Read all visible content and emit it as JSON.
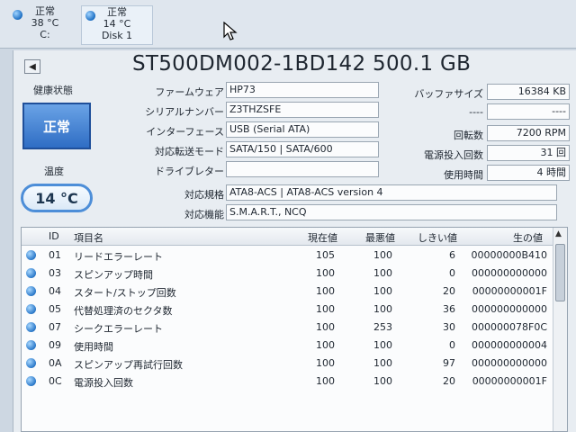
{
  "disks": [
    {
      "status": "正常",
      "temp": "38 °C",
      "name": "C:"
    },
    {
      "status": "正常",
      "temp": "14 °C",
      "name": "Disk 1"
    }
  ],
  "model": "ST500DM002-1BD142 500.1 GB",
  "health": {
    "label": "健康状態",
    "value": "正常"
  },
  "temperature": {
    "label": "温度",
    "value": "14 °C"
  },
  "info": {
    "firmware_label": "ファームウェア",
    "firmware": "HP73",
    "serial_label": "シリアルナンバー",
    "serial": "Z3THZSFE",
    "interface_label": "インターフェース",
    "interface": "USB (Serial ATA)",
    "transfer_label": "対応転送モード",
    "transfer": "SATA/150 | SATA/600",
    "drive_letter_label": "ドライブレター",
    "drive_letter": "",
    "standard_label": "対応規格",
    "standard": "ATA8-ACS | ATA8-ACS version 4",
    "features_label": "対応機能",
    "features": "S.M.A.R.T., NCQ"
  },
  "right_info": {
    "buffer_label": "バッファサイズ",
    "buffer": "16384 KB",
    "blank_label": "----",
    "blank": "----",
    "rpm_label": "回転数",
    "rpm": "7200 RPM",
    "power_count_label": "電源投入回数",
    "power_count": "31 回",
    "power_hours_label": "使用時間",
    "power_hours": "4 時間"
  },
  "table": {
    "headers": {
      "id": "ID",
      "name": "項目名",
      "current": "現在値",
      "worst": "最悪値",
      "threshold": "しきい値",
      "raw": "生の値"
    },
    "rows": [
      {
        "id": "01",
        "name": "リードエラーレート",
        "current": "105",
        "worst": "100",
        "threshold": "6",
        "raw": "00000000B410"
      },
      {
        "id": "03",
        "name": "スピンアップ時間",
        "current": "100",
        "worst": "100",
        "threshold": "0",
        "raw": "000000000000"
      },
      {
        "id": "04",
        "name": "スタート/ストップ回数",
        "current": "100",
        "worst": "100",
        "threshold": "20",
        "raw": "00000000001F"
      },
      {
        "id": "05",
        "name": "代替処理済のセクタ数",
        "current": "100",
        "worst": "100",
        "threshold": "36",
        "raw": "000000000000"
      },
      {
        "id": "07",
        "name": "シークエラーレート",
        "current": "100",
        "worst": "253",
        "threshold": "30",
        "raw": "000000078F0C"
      },
      {
        "id": "09",
        "name": "使用時間",
        "current": "100",
        "worst": "100",
        "threshold": "0",
        "raw": "000000000004"
      },
      {
        "id": "0A",
        "name": "スピンアップ再試行回数",
        "current": "100",
        "worst": "100",
        "threshold": "97",
        "raw": "000000000000"
      },
      {
        "id": "0C",
        "name": "電源投入回数",
        "current": "100",
        "worst": "100",
        "threshold": "20",
        "raw": "00000000001F"
      }
    ]
  }
}
